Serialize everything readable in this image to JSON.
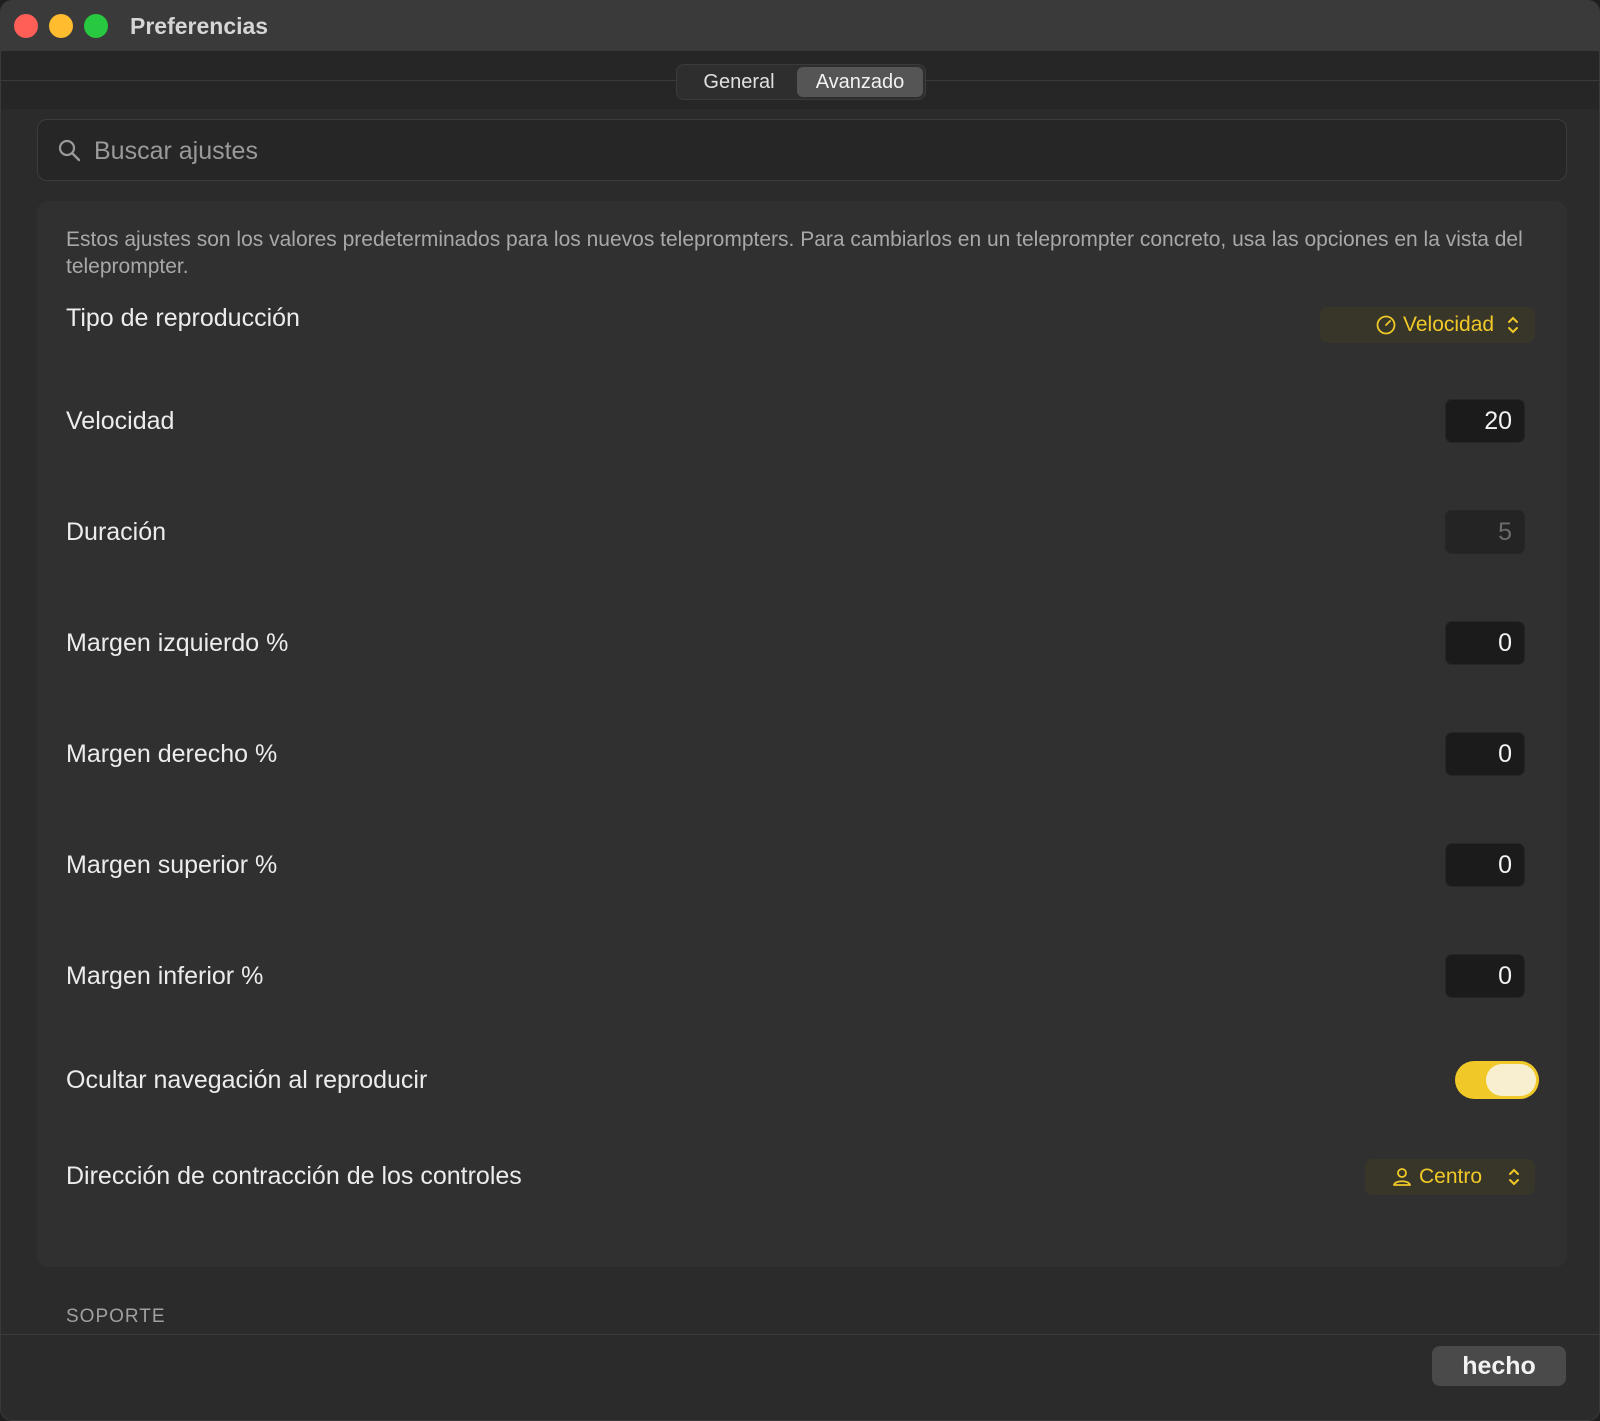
{
  "window": {
    "title": "Preferencias"
  },
  "tabs": [
    {
      "label": "General",
      "selected": false
    },
    {
      "label": "Avanzado",
      "selected": true
    }
  ],
  "search": {
    "placeholder": "Buscar ajustes",
    "value": ""
  },
  "settings": {
    "description": "Estos ajustes son los valores predeterminados para los nuevos teleprompters. Para cambiarlos en un teleprompter concreto, usa las opciones en la vista del teleprompter.",
    "playback_type": {
      "label": "Tipo de reproducción",
      "value": "Velocidad",
      "icon": "speedometer-icon"
    },
    "speed": {
      "label": "Velocidad",
      "value": "20"
    },
    "duration": {
      "label": "Duración",
      "value": "5",
      "disabled": true
    },
    "margin_left": {
      "label": "Margen izquierdo %",
      "value": "0"
    },
    "margin_right": {
      "label": "Margen derecho %",
      "value": "0"
    },
    "margin_top": {
      "label": "Margen superior %",
      "value": "0"
    },
    "margin_bottom": {
      "label": "Margen inferior %",
      "value": "0"
    },
    "hide_nav": {
      "label": "Ocultar navegación al reproducir",
      "on": true
    },
    "collapse_direction": {
      "label": "Dirección de contracción de los controles",
      "value": "Centro",
      "icon": "person-icon"
    }
  },
  "support": {
    "header": "SOPORTE"
  },
  "footer": {
    "done_label": "hecho"
  },
  "colors": {
    "accent": "#f0c928",
    "background": "#2b2b2b",
    "panel": "#303030"
  }
}
